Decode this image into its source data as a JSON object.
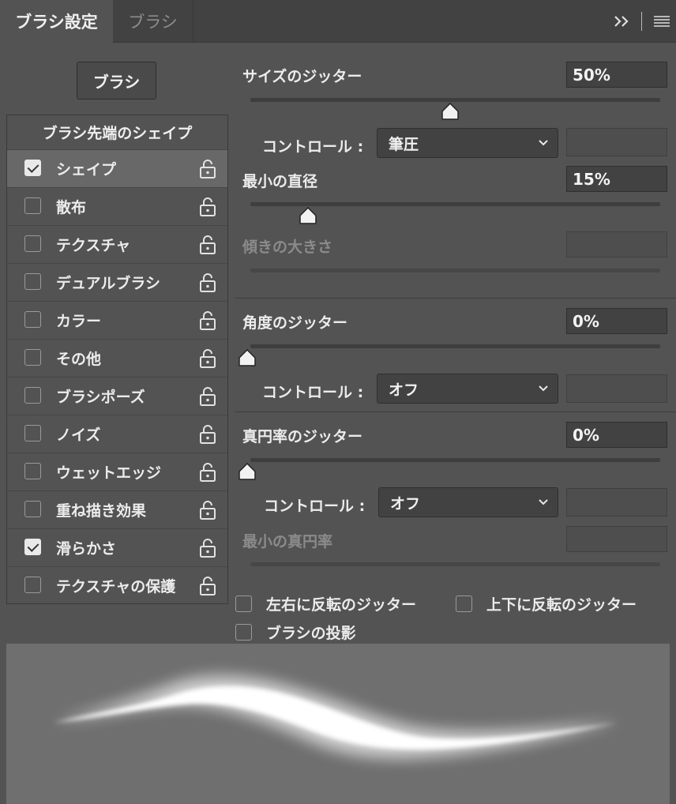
{
  "tabs": [
    {
      "label": "ブラシ設定",
      "active": true
    },
    {
      "label": "ブラシ",
      "active": false
    }
  ],
  "toolbar": {
    "expand_icon": "double-chevron-right-icon",
    "menu_icon": "hamburger-menu-icon"
  },
  "brush_button": {
    "label": "ブラシ"
  },
  "list": {
    "header": "ブラシ先端のシェイプ",
    "items": [
      {
        "label": "シェイプ",
        "checked": true,
        "selected": true
      },
      {
        "label": "散布",
        "checked": false
      },
      {
        "label": "テクスチャ",
        "checked": false
      },
      {
        "label": "デュアルブラシ",
        "checked": false
      },
      {
        "label": "カラー",
        "checked": false
      },
      {
        "label": "その他",
        "checked": false
      },
      {
        "label": "ブラシポーズ",
        "checked": false
      },
      {
        "label": "ノイズ",
        "checked": false
      },
      {
        "label": "ウェットエッジ",
        "checked": false
      },
      {
        "label": "重ね描き効果",
        "checked": false
      },
      {
        "label": "滑らかさ",
        "checked": true
      },
      {
        "label": "テクスチャの保護",
        "checked": false
      }
    ]
  },
  "settings": {
    "size_jitter": {
      "label": "サイズのジッター",
      "value": "50%",
      "fraction": 0.5
    },
    "control1": {
      "label": "コントロール :",
      "value": "筆圧"
    },
    "min_diameter": {
      "label": "最小の直径",
      "value": "15%",
      "fraction": 0.15
    },
    "tilt_scale": {
      "label": "傾きの大きさ"
    },
    "angle_jitter": {
      "label": "角度のジッター",
      "value": "0%",
      "fraction": 0
    },
    "control2": {
      "label": "コントロール :",
      "value": "オフ"
    },
    "roundness_jitter": {
      "label": "真円率のジッター",
      "value": "0%",
      "fraction": 0
    },
    "control3": {
      "label": "コントロール :",
      "value": "オフ"
    },
    "min_roundness": {
      "label": "最小の真円率"
    },
    "flip_x": {
      "label": "左右に反転のジッター",
      "checked": false
    },
    "flip_y": {
      "label": "上下に反転のジッター",
      "checked": false
    },
    "projection": {
      "label": "ブラシの投影",
      "checked": false
    }
  },
  "colors": {
    "panel": "#535353",
    "tabbar": "#424242",
    "field": "#424242",
    "preview": "#6f6f6f"
  }
}
